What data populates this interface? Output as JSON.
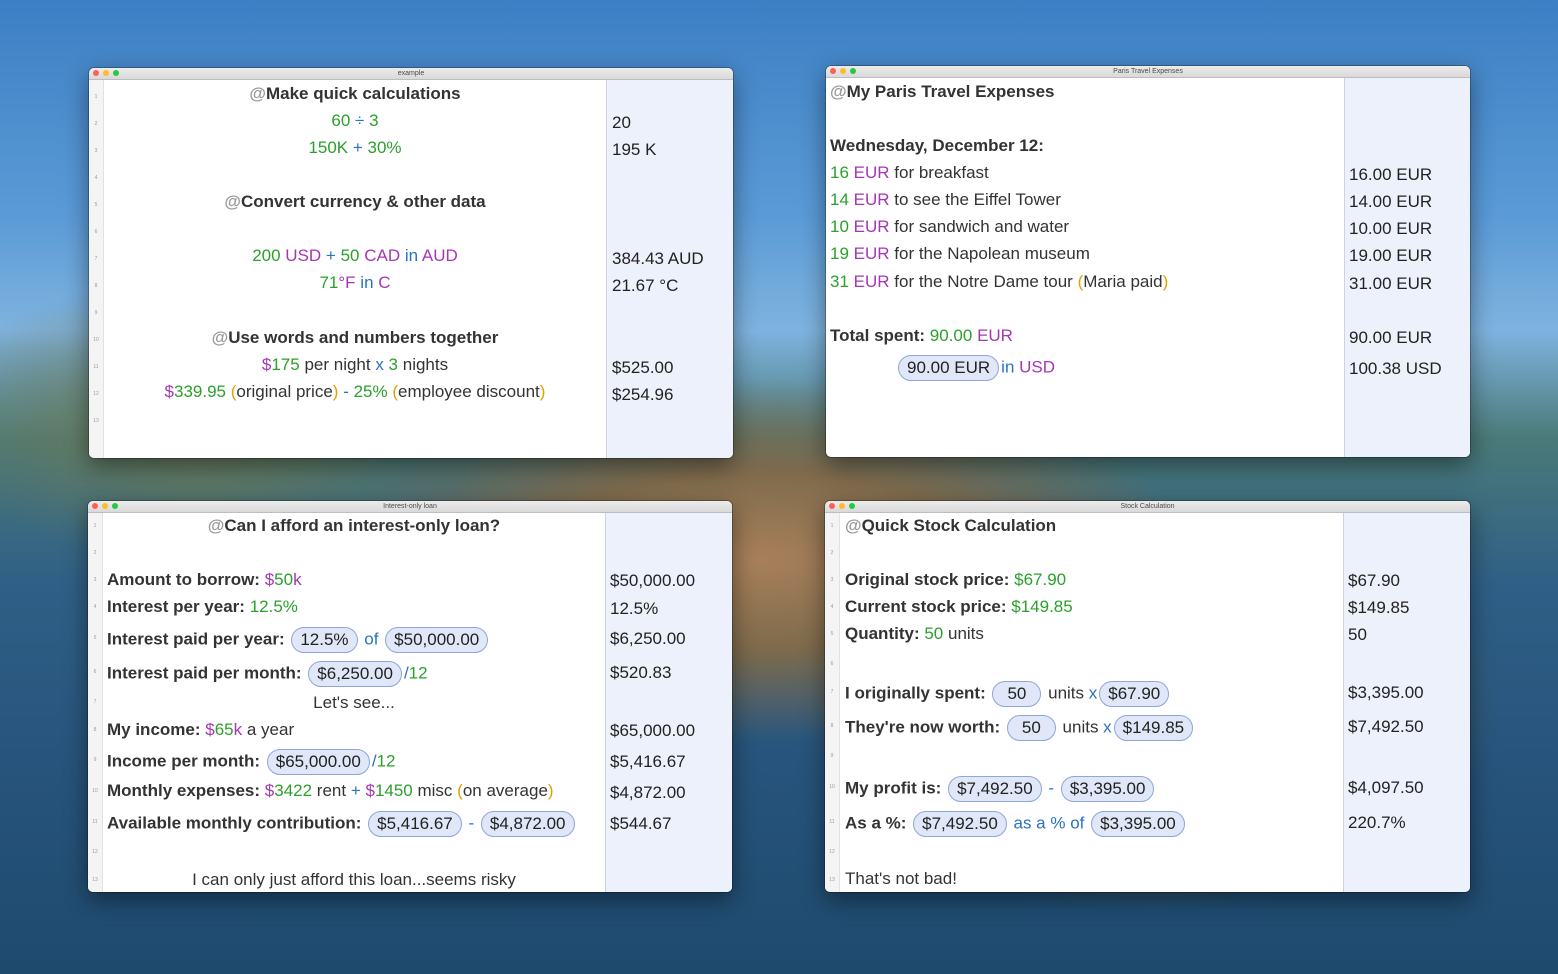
{
  "colors": {
    "number": "#2ba02b",
    "unit": "#a536b4",
    "operator": "#2a73c2",
    "paren": "#e0a100",
    "at": "#999999"
  },
  "w1": {
    "title": "example",
    "line_numbers": [
      "1",
      "2",
      "3",
      "4",
      "5",
      "6",
      "7",
      "8",
      "9",
      "10",
      "11",
      "12",
      "13"
    ],
    "lines": {
      "l1_at": "@",
      "l1_text": "Make quick calculations",
      "l2_a": "60",
      "l2_op": " ÷ ",
      "l2_b": "3",
      "l3_a": "150K",
      "l3_op": " + ",
      "l3_b": "30%",
      "l5_at": "@",
      "l5_text": "Convert currency & other data",
      "l7_n1": "200",
      "l7_u1": " USD",
      "l7_op": " + ",
      "l7_n2": "50",
      "l7_u2": " CAD",
      "l7_in": " in ",
      "l7_u3": "AUD",
      "l8_n": "71",
      "l8_u": "°F",
      "l8_in": " in ",
      "l8_u2": "C",
      "l10_at": "@",
      "l10_text": "Use words and numbers together",
      "l11_cur": "$",
      "l11_n": "175",
      "l11_t1": " per night ",
      "l11_x": "x",
      "l11_n2": " 3",
      "l11_t2": " nights",
      "l12_cur": "$",
      "l12_n": "339.95",
      "l12_po": " (",
      "l12_t1": "original price",
      "l12_pc": ")",
      "l12_op": " - ",
      "l12_n2": "25%",
      "l12_po2": " (",
      "l12_t2": "employee discount",
      "l12_pc2": ")"
    },
    "results": {
      "r2": "20",
      "r3": "195 K",
      "r7": "384.43 AUD",
      "r8": "21.67 °C",
      "r11": "$525.00",
      "r12": "$254.96"
    }
  },
  "w2": {
    "title": "Paris Travel Expenses",
    "lines": {
      "l1_at": "@",
      "l1_text": "My Paris Travel Expenses",
      "l3": "Wednesday, December 12:",
      "e1_n": "16",
      "e1_u": " EUR",
      "e1_t": " for breakfast",
      "e2_n": "14",
      "e2_u": " EUR",
      "e2_t": " to see the Eiffel Tower",
      "e3_n": "10",
      "e3_u": " EUR",
      "e3_t": " for sandwich and water",
      "e4_n": "19",
      "e4_u": " EUR",
      "e4_t": " for the Napolean museum",
      "e5_n": "31",
      "e5_u": " EUR",
      "e5_t": " for the Notre Dame tour ",
      "e5_po": "(",
      "e5_t2": "Maria paid",
      "e5_pc": ")",
      "tot_label": "Total spent: ",
      "tot_n": "90.00",
      "tot_u": " EUR",
      "conv_tok": "90.00 EUR",
      "conv_in": "in ",
      "conv_u": "USD"
    },
    "results": {
      "e1": "16.00 EUR",
      "e2": "14.00 EUR",
      "e3": "10.00 EUR",
      "e4": "19.00 EUR",
      "e5": "31.00 EUR",
      "tot": "90.00 EUR",
      "conv": "100.38 USD"
    }
  },
  "w3": {
    "title": "Interest-only loan",
    "line_numbers": [
      "1",
      "2",
      "3",
      "4",
      "5",
      "6",
      "7",
      "8",
      "9",
      "10",
      "11",
      "12",
      "13"
    ],
    "lines": {
      "l1_at": "@",
      "l1_text": "Can I afford an interest-only loan?",
      "l3_label": "Amount to borrow: ",
      "l3_cur": "$",
      "l3_n": "50",
      "l3_k": "k",
      "l4_label": "Interest per year: ",
      "l4_n": "12.5%",
      "l5_label": "Interest paid per year: ",
      "l5_tok1": "12.5%",
      "l5_of": " of ",
      "l5_tok2": "$50,000.00",
      "l6_label": "Interest paid per month: ",
      "l6_tok": "$6,250.00",
      "l6_div": "/",
      "l6_n": "12",
      "l7": "Let's see...",
      "l8_label": "My income: ",
      "l8_cur": "$",
      "l8_n": "65",
      "l8_k": "k",
      "l8_t": " a year",
      "l9_label": "Income per month: ",
      "l9_tok": "$65,000.00",
      "l9_div": "/",
      "l9_n": "12",
      "l10_label": "Monthly expenses: ",
      "l10_cur": "$",
      "l10_n": "3422",
      "l10_t1": " rent ",
      "l10_op": "+",
      "l10_cur2": " $",
      "l10_n2": "1450",
      "l10_t2": " misc ",
      "l10_po": "(",
      "l10_t3": "on average",
      "l10_pc": ")",
      "l11_label": "Available monthly contribution: ",
      "l11_tok1": "$5,416.67",
      "l11_op": " - ",
      "l11_tok2": "$4,872.00",
      "l13": "I can only just afford this loan...seems risky"
    },
    "results": {
      "r3": "$50,000.00",
      "r4": "12.5%",
      "r5": "$6,250.00",
      "r6": "$520.83",
      "r8": "$65,000.00",
      "r9": "$5,416.67",
      "r10": "$4,872.00",
      "r11": "$544.67"
    }
  },
  "w4": {
    "title": "Stock Calculation",
    "line_numbers": [
      "1",
      "2",
      "3",
      "4",
      "5",
      "6",
      "7",
      "8",
      "9",
      "10",
      "11",
      "12",
      "13"
    ],
    "lines": {
      "l1_at": "@",
      "l1_text": "Quick Stock Calculation",
      "l3_label": "Original stock price: ",
      "l3_n": "$67.90",
      "l4_label": "Current stock price: ",
      "l4_n": "$149.85",
      "l5_label": "Quantity: ",
      "l5_n": "50",
      "l5_t": " units",
      "l7_label": "I originally spent: ",
      "l7_tok1": "50",
      "l7_t": " units ",
      "l7_x": "x",
      "l7_tok2": "$67.90",
      "l8_label": "They're now worth: ",
      "l8_tok1": "50",
      "l8_t": " units ",
      "l8_x": "x",
      "l8_tok2": "$149.85",
      "l10_label": "My profit is: ",
      "l10_tok1": "$7,492.50",
      "l10_op": " - ",
      "l10_tok2": "$3,395.00",
      "l11_label": "As a %: ",
      "l11_tok1": "$7,492.50",
      "l11_op": " as a % of ",
      "l11_tok2": "$3,395.00",
      "l13": "That's not bad!"
    },
    "results": {
      "r3": "$67.90",
      "r4": "$149.85",
      "r5": "50",
      "r7": "$3,395.00",
      "r8": "$7,492.50",
      "r10": "$4,097.50",
      "r11": "220.7%"
    }
  }
}
